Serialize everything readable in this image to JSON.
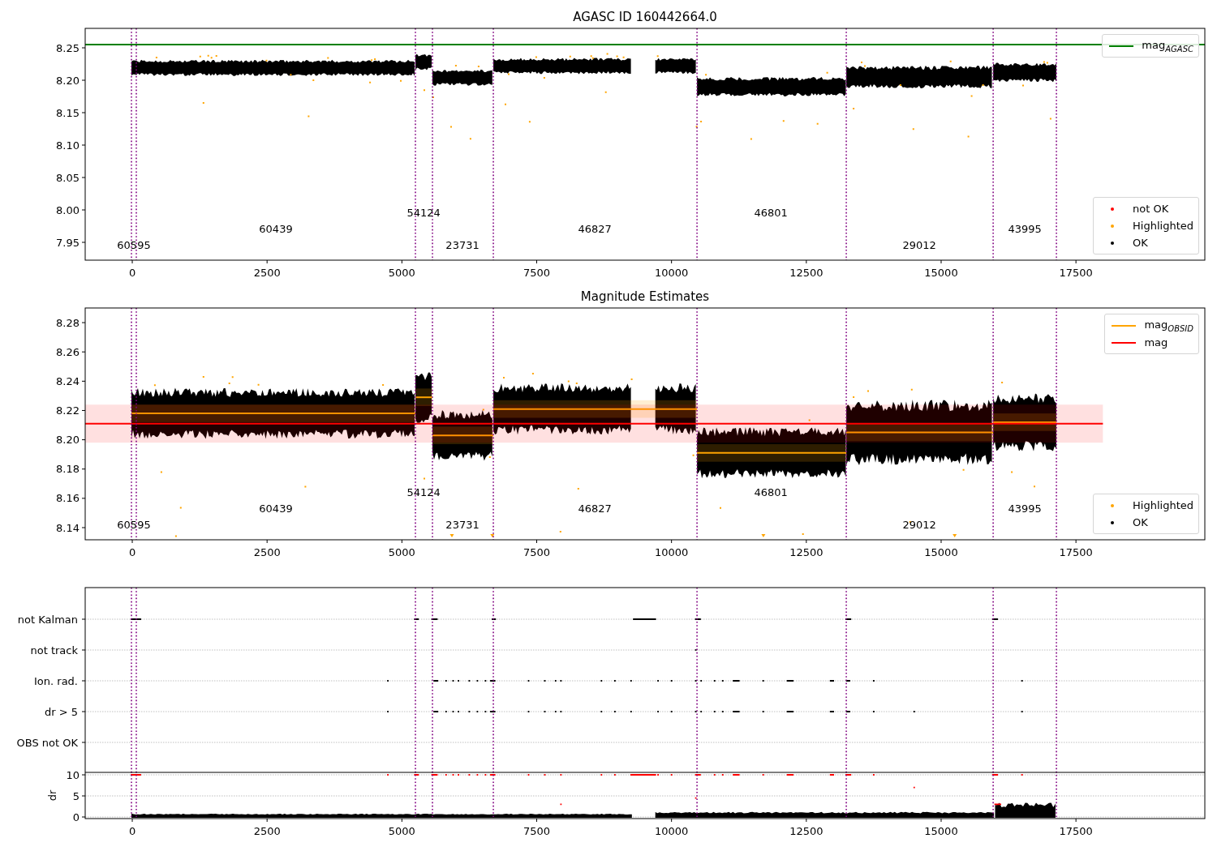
{
  "panels": [
    {
      "kind": "magnitude",
      "title": "AGASC ID 160442664.0",
      "y_tick_labels": [
        "8.25",
        "8.20",
        "8.15",
        "8.10",
        "8.05",
        "8.00",
        "7.95"
      ],
      "x_tick_labels": [
        "0",
        "2500",
        "5000",
        "7500",
        "10000",
        "12500",
        "15000",
        "17500"
      ],
      "obsid_labels": [
        "60595",
        "60439",
        "54124",
        "23731",
        "46827",
        "46801",
        "29012",
        "43995"
      ],
      "legends": [
        {
          "entries": [
            {
              "name": "mag$_{AGASC}$",
              "color": "#008000",
              "kind": "line"
            }
          ]
        },
        {
          "entries": [
            {
              "name": "not OK",
              "color": "#ff0000",
              "kind": "marker"
            },
            {
              "name": "Highlighted",
              "color": "#ffa500",
              "kind": "marker"
            },
            {
              "name": "OK",
              "color": "#000000",
              "kind": "marker"
            }
          ]
        }
      ]
    },
    {
      "kind": "magnitude",
      "title": "Magnitude Estimates",
      "y_tick_labels": [
        "8.28",
        "8.26",
        "8.24",
        "8.22",
        "8.20",
        "8.18",
        "8.16",
        "8.14"
      ],
      "x_tick_labels": [
        "0",
        "2500",
        "5000",
        "7500",
        "10000",
        "12500",
        "15000",
        "17500"
      ],
      "obsid_labels": [
        "60595",
        "60439",
        "54124",
        "23731",
        "46827",
        "46801",
        "29012",
        "43995"
      ],
      "legends": [
        {
          "entries": [
            {
              "name": "mag$_{OBSID}$",
              "color": "#ffa500",
              "kind": "line"
            },
            {
              "name": "mag",
              "color": "#ff0000",
              "kind": "line"
            }
          ]
        },
        {
          "entries": [
            {
              "name": "Highlighted",
              "color": "#ffa500",
              "kind": "marker"
            },
            {
              "name": "OK",
              "color": "#000000",
              "kind": "marker"
            }
          ]
        }
      ]
    },
    {
      "kind": "flags",
      "flag_labels": [
        "not Kalman",
        "not track",
        "Ion. rad.",
        "dr > 5",
        "OBS not OK"
      ],
      "y_label": "dr",
      "y_tick_labels": [
        "10",
        "5",
        "0"
      ],
      "x_tick_labels": [
        "0",
        "2500",
        "5000",
        "7500",
        "10000",
        "12500",
        "15000",
        "17500"
      ]
    }
  ]
}
